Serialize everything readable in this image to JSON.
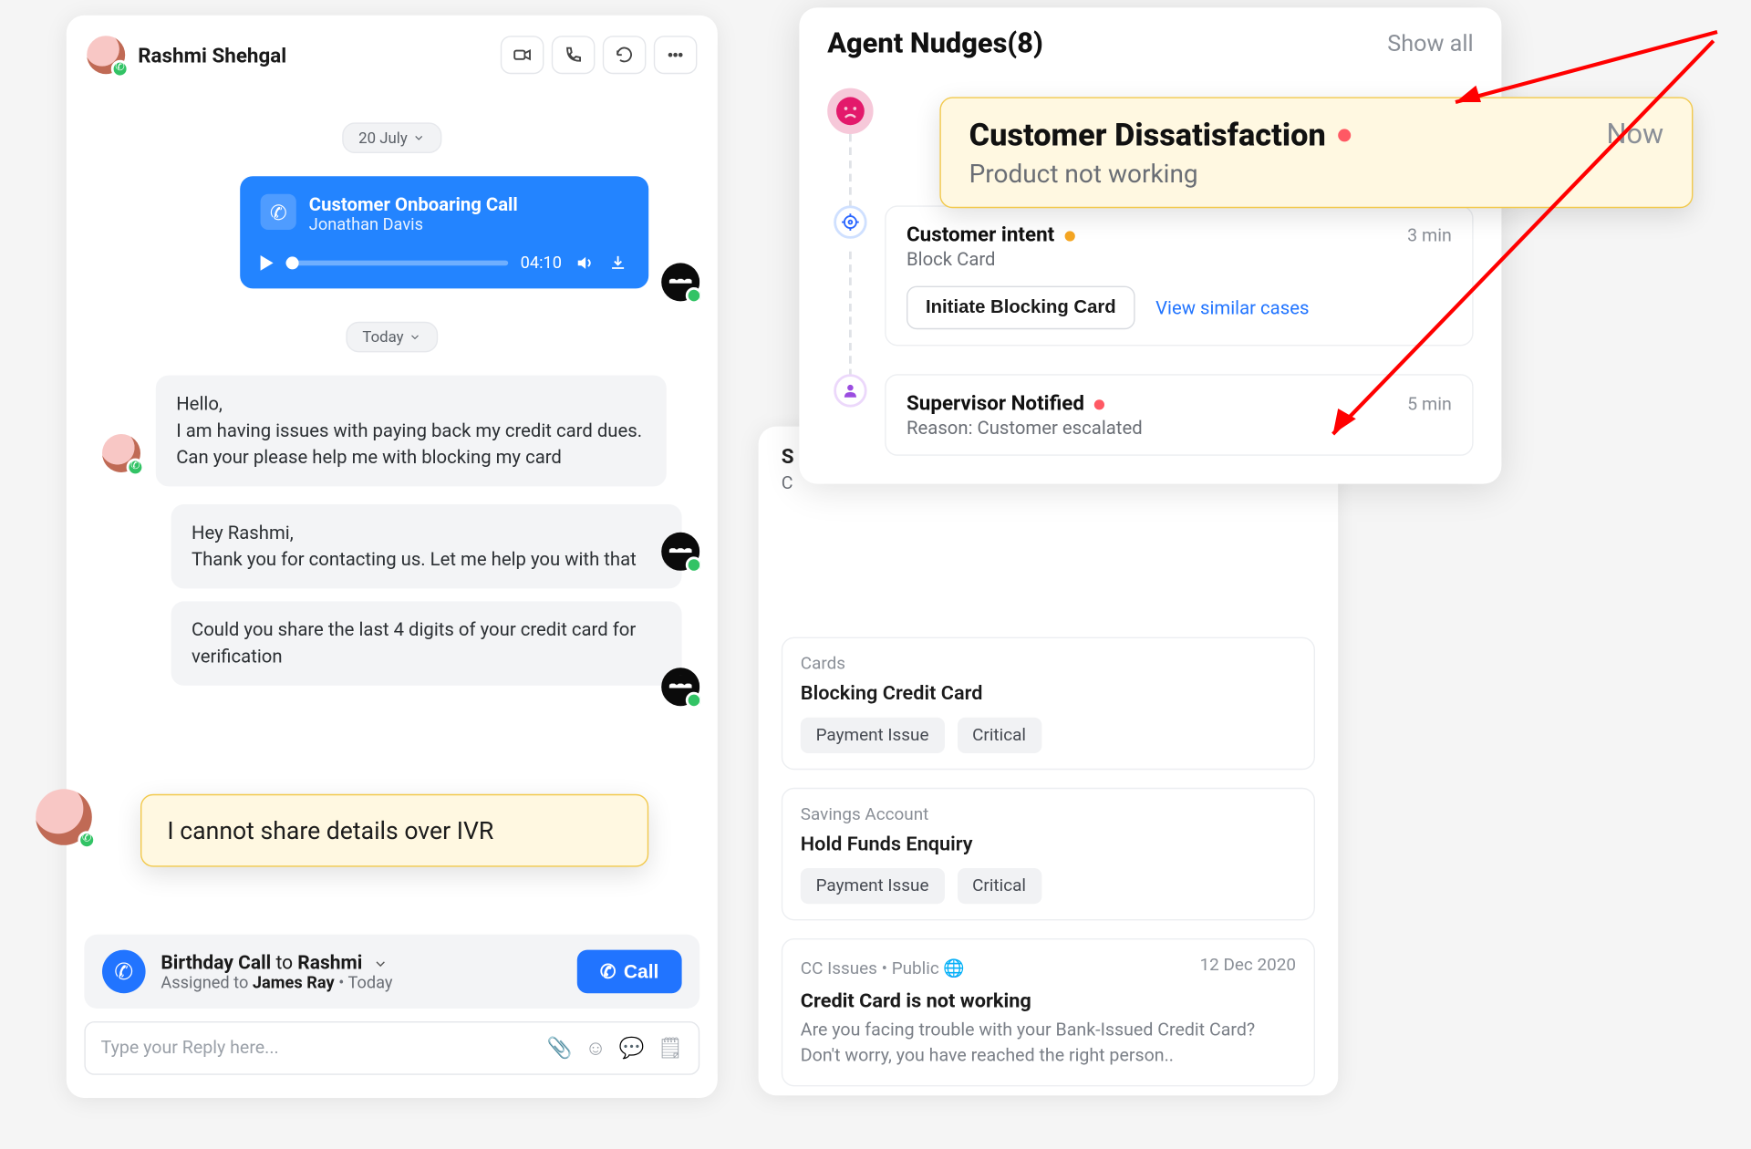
{
  "chat": {
    "contact_name": "Rashmi Shehgal",
    "date1": "20 July",
    "date2": "Today",
    "voice": {
      "title": "Customer Onboaring Call",
      "presenter": "Jonathan Davis",
      "duration": "04:10"
    },
    "msgs": {
      "m1": "Hello,\nI am having issues with paying back my credit card dues. Can your please help me with blocking my card",
      "m2": "Hey Rashmi,\nThank you for contacting us. Let me help you with that",
      "m3": "Could you share the last 4 digits of your credit card for verification"
    },
    "highlight_msg": "I cannot share details over IVR",
    "assign": {
      "title_a": "Birthday Call",
      "title_to": " to ",
      "title_b": "Rashmi",
      "sub_pre": "Assigned to ",
      "assignee": "James Ray",
      "sub_post": "  •  Today",
      "call_btn": "Call"
    },
    "reply_placeholder": "Type your Reply here..."
  },
  "right": {
    "header_partial": "S",
    "cat1": "Cards",
    "title1": "Blocking Credit Card",
    "chip_a": "Payment Issue",
    "chip_b": "Critical",
    "cat2": "Savings Account",
    "title2": "Hold Funds Enquiry",
    "kb_meta": "CC Issues  •  Public ",
    "kb_date": "12 Dec 2020",
    "kb_title": "Credit Card is not working",
    "kb_desc": "Are you facing trouble with your Bank-Issued Credit Card? Don't worry, you have reached the right person.."
  },
  "nudges": {
    "header": "Agent Nudges(8)",
    "showall": "Show all",
    "intent": {
      "title": "Customer intent",
      "sub": "Block Card",
      "time": "3 min",
      "action": "Initiate Blocking Card",
      "link": "View similar cases"
    },
    "supervisor": {
      "title": "Supervisor Notified",
      "sub": "Reason: Customer escalated",
      "time": "5 min"
    }
  },
  "dissat": {
    "title": "Customer Dissatisfaction",
    "sub": "Product not working",
    "time": "Now"
  }
}
